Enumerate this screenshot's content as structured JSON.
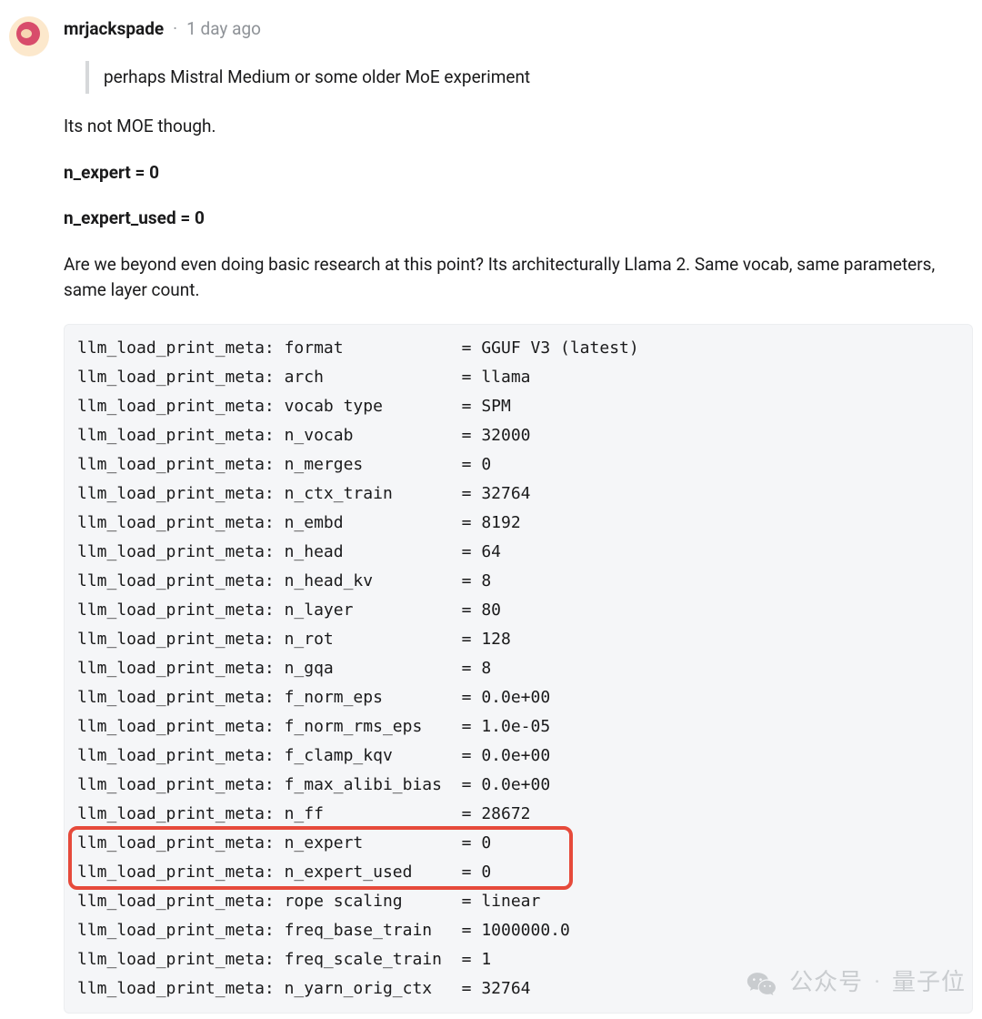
{
  "comment": {
    "username": "mrjackspade",
    "separator": "·",
    "timestamp": "1 day ago",
    "quote": "perhaps Mistral Medium or some older MoE experiment",
    "para1": "Its not MOE though.",
    "line_n_expert": "n_expert = 0",
    "line_n_expert_used": "n_expert_used = 0",
    "para2": "Are we beyond even doing basic research at this point? Its architecturally Llama 2. Same vocab, same parameters, same layer count."
  },
  "code": {
    "prefix": "llm_load_print_meta:",
    "lines": [
      {
        "key": "format",
        "value": "GGUF V3 (latest)"
      },
      {
        "key": "arch",
        "value": "llama"
      },
      {
        "key": "vocab type",
        "value": "SPM"
      },
      {
        "key": "n_vocab",
        "value": "32000"
      },
      {
        "key": "n_merges",
        "value": "0"
      },
      {
        "key": "n_ctx_train",
        "value": "32764"
      },
      {
        "key": "n_embd",
        "value": "8192"
      },
      {
        "key": "n_head",
        "value": "64"
      },
      {
        "key": "n_head_kv",
        "value": "8"
      },
      {
        "key": "n_layer",
        "value": "80"
      },
      {
        "key": "n_rot",
        "value": "128"
      },
      {
        "key": "n_gqa",
        "value": "8"
      },
      {
        "key": "f_norm_eps",
        "value": "0.0e+00"
      },
      {
        "key": "f_norm_rms_eps",
        "value": "1.0e-05"
      },
      {
        "key": "f_clamp_kqv",
        "value": "0.0e+00"
      },
      {
        "key": "f_max_alibi_bias",
        "value": "0.0e+00"
      },
      {
        "key": "n_ff",
        "value": "28672"
      },
      {
        "key": "n_expert",
        "value": "0"
      },
      {
        "key": "n_expert_used",
        "value": "0"
      },
      {
        "key": "rope scaling",
        "value": "linear"
      },
      {
        "key": "freq_base_train",
        "value": "1000000.0"
      },
      {
        "key": "freq_scale_train",
        "value": "1"
      },
      {
        "key": "n_yarn_orig_ctx",
        "value": "32764"
      }
    ],
    "key_col_width": 18,
    "highlight_start_index": 17,
    "highlight_end_index": 18
  },
  "watermark": {
    "left": "公众号",
    "sep": "·",
    "right": "量子位"
  }
}
